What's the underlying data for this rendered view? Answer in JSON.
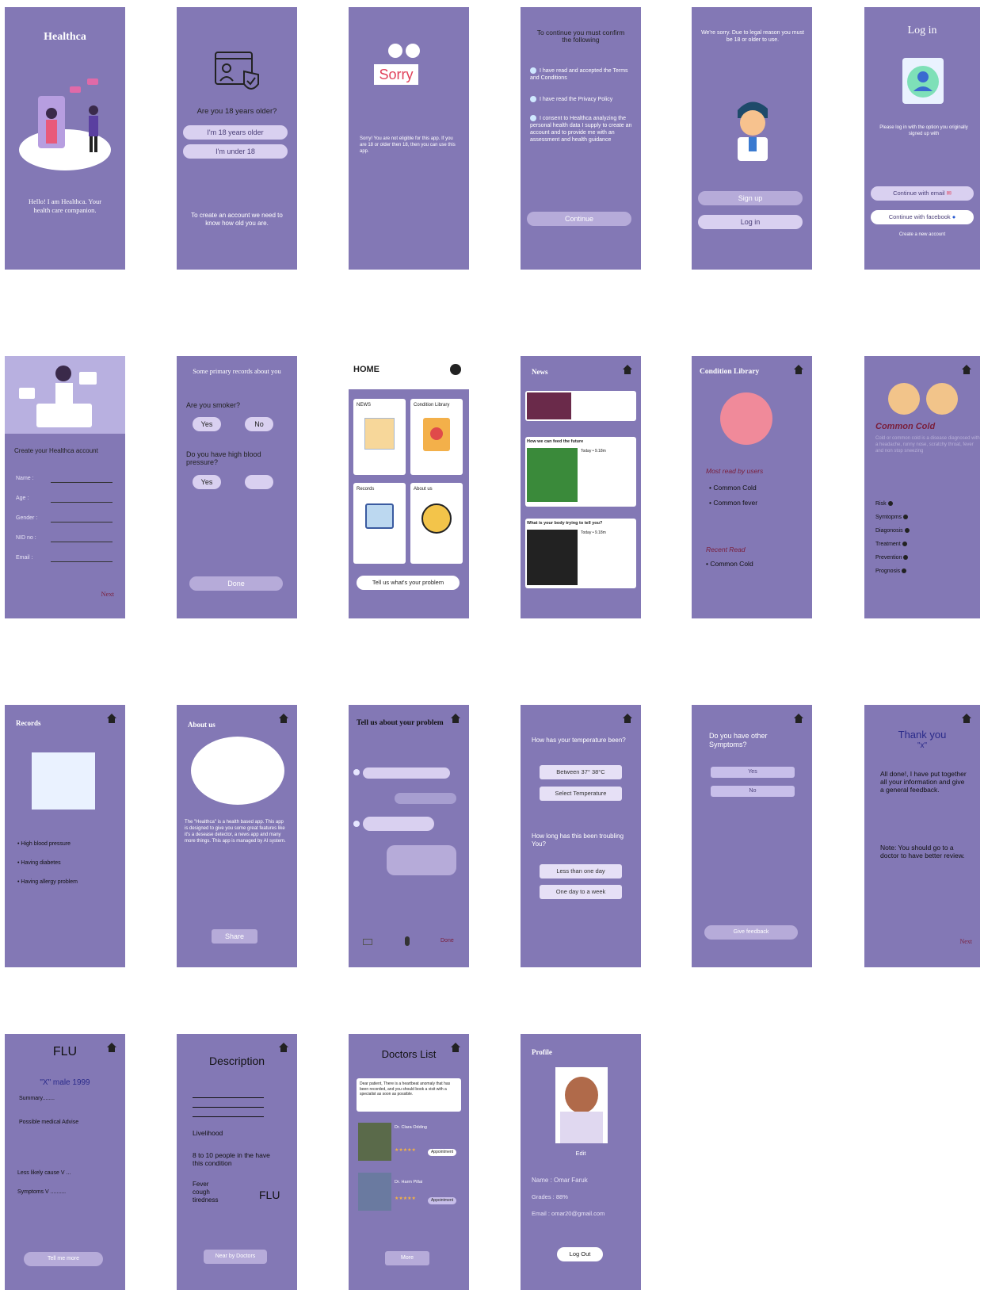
{
  "s1": {
    "title": "Healthca",
    "tagline": "Hello! I am Healthca. Your health care companion."
  },
  "s2": {
    "question": "Are you 18 years older?",
    "btn_older": "I'm 18 years older",
    "btn_under": "I'm under 18",
    "note": "To create an account we need to know how old you are."
  },
  "s3": {
    "sorry_label": "Sorry",
    "message": "Sorry! You are not eligible for this app. If you are 18 or older then 18, then you can use this app."
  },
  "s4": {
    "title": "To continue you must confirm the following",
    "items": [
      "I have read and accepted the Terms and Conditions",
      "I have read the Privacy Policy",
      "I consent to Healthca analyzing the personal health data I supply to create an account and to provide me with an assessment and health guidance"
    ],
    "continue": "Continue"
  },
  "s5": {
    "message": "We're sorry. Due to legal reason you must be 18 or older to use.",
    "sign_up": "Sign up",
    "log_in": "Log in"
  },
  "s6": {
    "title": "Log in",
    "message": "Please log in with the option you originally signed up with",
    "email_btn": "Continue with email",
    "facebook_btn": "Continue with facebook",
    "create": "Create a new account"
  },
  "s7": {
    "heading": "Create your Healthca account",
    "fields": [
      "Name  :",
      "Age   :",
      "Gender :",
      "NID no :",
      "Email  :"
    ],
    "next": "Next"
  },
  "s8": {
    "heading": "Some primary records about you",
    "q1": "Are you smoker?",
    "yes": "Yes",
    "no": "No",
    "q2": "Do you have high blood pressure?",
    "yes2": "Yes",
    "done": "Done"
  },
  "s9": {
    "title": "HOME",
    "tiles": [
      "NEWS",
      "Condition Library",
      "Records",
      "About us"
    ],
    "cta": "Tell us what's your problem"
  },
  "s10": {
    "title": "News",
    "headline1": "How we can feed the future",
    "headline2": "What is your body trying to tell you?",
    "meta1": "Today • 9.18m",
    "meta2": "Today • 9.18m"
  },
  "s11": {
    "title": "Condition Library",
    "most_read": "Most read by users",
    "most_items": [
      "Common Cold",
      "Common fever"
    ],
    "recent": "Recent Read",
    "recent_items": [
      "Common Cold"
    ]
  },
  "s12": {
    "title": "Common Cold",
    "desc": "Cold or common cold is a disease diagnosed with a headache, runny nose, scratchy throat, fever and non stop sneezing",
    "items": [
      "Risk",
      "Symtopms",
      "Diagonosis",
      "Treatment",
      "Prevention",
      "Prognosis"
    ]
  },
  "s13": {
    "title": "Records",
    "items": [
      "High blood pressure",
      "Having diabetes",
      "Having allergy problem"
    ]
  },
  "s14": {
    "title": "About us",
    "text": "The \"Healthca\" is a health based app. This app is designed to give you some great features like it's a desease detector, a news app and many more things. This app is managed by AI system.",
    "share": "Share"
  },
  "s15": {
    "title": "Tell us about your problem",
    "done": "Done"
  },
  "s16": {
    "q1": "How has your temperature been?",
    "opt1": "Between 37°   38°C",
    "opt2": "Select Temperature",
    "q2": "How long has this been troubling You?",
    "opt3": "Less than one day",
    "opt4": "One day to a week"
  },
  "s17": {
    "q": "Do you have other Symptoms?",
    "yes": "Yes",
    "no": "No",
    "feedback": "Give feedback"
  },
  "s18": {
    "title": "Thank you",
    "name": "\"x\"",
    "msg": "All done!, I have put together all your information and give a general feedback.",
    "note": "Note: You should go to a doctor to have better review.",
    "next": "Next"
  },
  "s19": {
    "title": "FLU",
    "subtitle": "\"X\" male 1999",
    "summary": "Summary",
    "advise": "Possible medical Advise",
    "less": "Less likely cause V ...",
    "symptoms": "Symptoms V",
    "btn": "Tell me more"
  },
  "s20": {
    "title": "Description",
    "livelihood": "Livelihood",
    "stat": "8 to 10 people in the have this condition",
    "sym": [
      "Fever",
      "cough",
      "tiredness"
    ],
    "result": "FLU",
    "btn": "Near by Doctors"
  },
  "s21": {
    "title": "Doctors List",
    "note": "Dear patient, There is a heartbeat anomaly that has been recorded, and you should book a visit with a specialist as soon as possible.",
    "doc1": "Dr. Clara Odding",
    "doc2": "Dr. Harm Pillai",
    "appt": "Appointment",
    "more": "More"
  },
  "s22": {
    "title": "Profile",
    "edit": "Edit",
    "name_label": "Name",
    "name": ": Omar Faruk",
    "grades": "Grades : 88%",
    "email_label": "Email",
    "email": ": omar20@gmail.com",
    "logout": "Log Out"
  },
  "colors": {
    "screen": "#8378b5",
    "pill": "#d9d0f0",
    "accent_red": "#7a1e3a"
  }
}
